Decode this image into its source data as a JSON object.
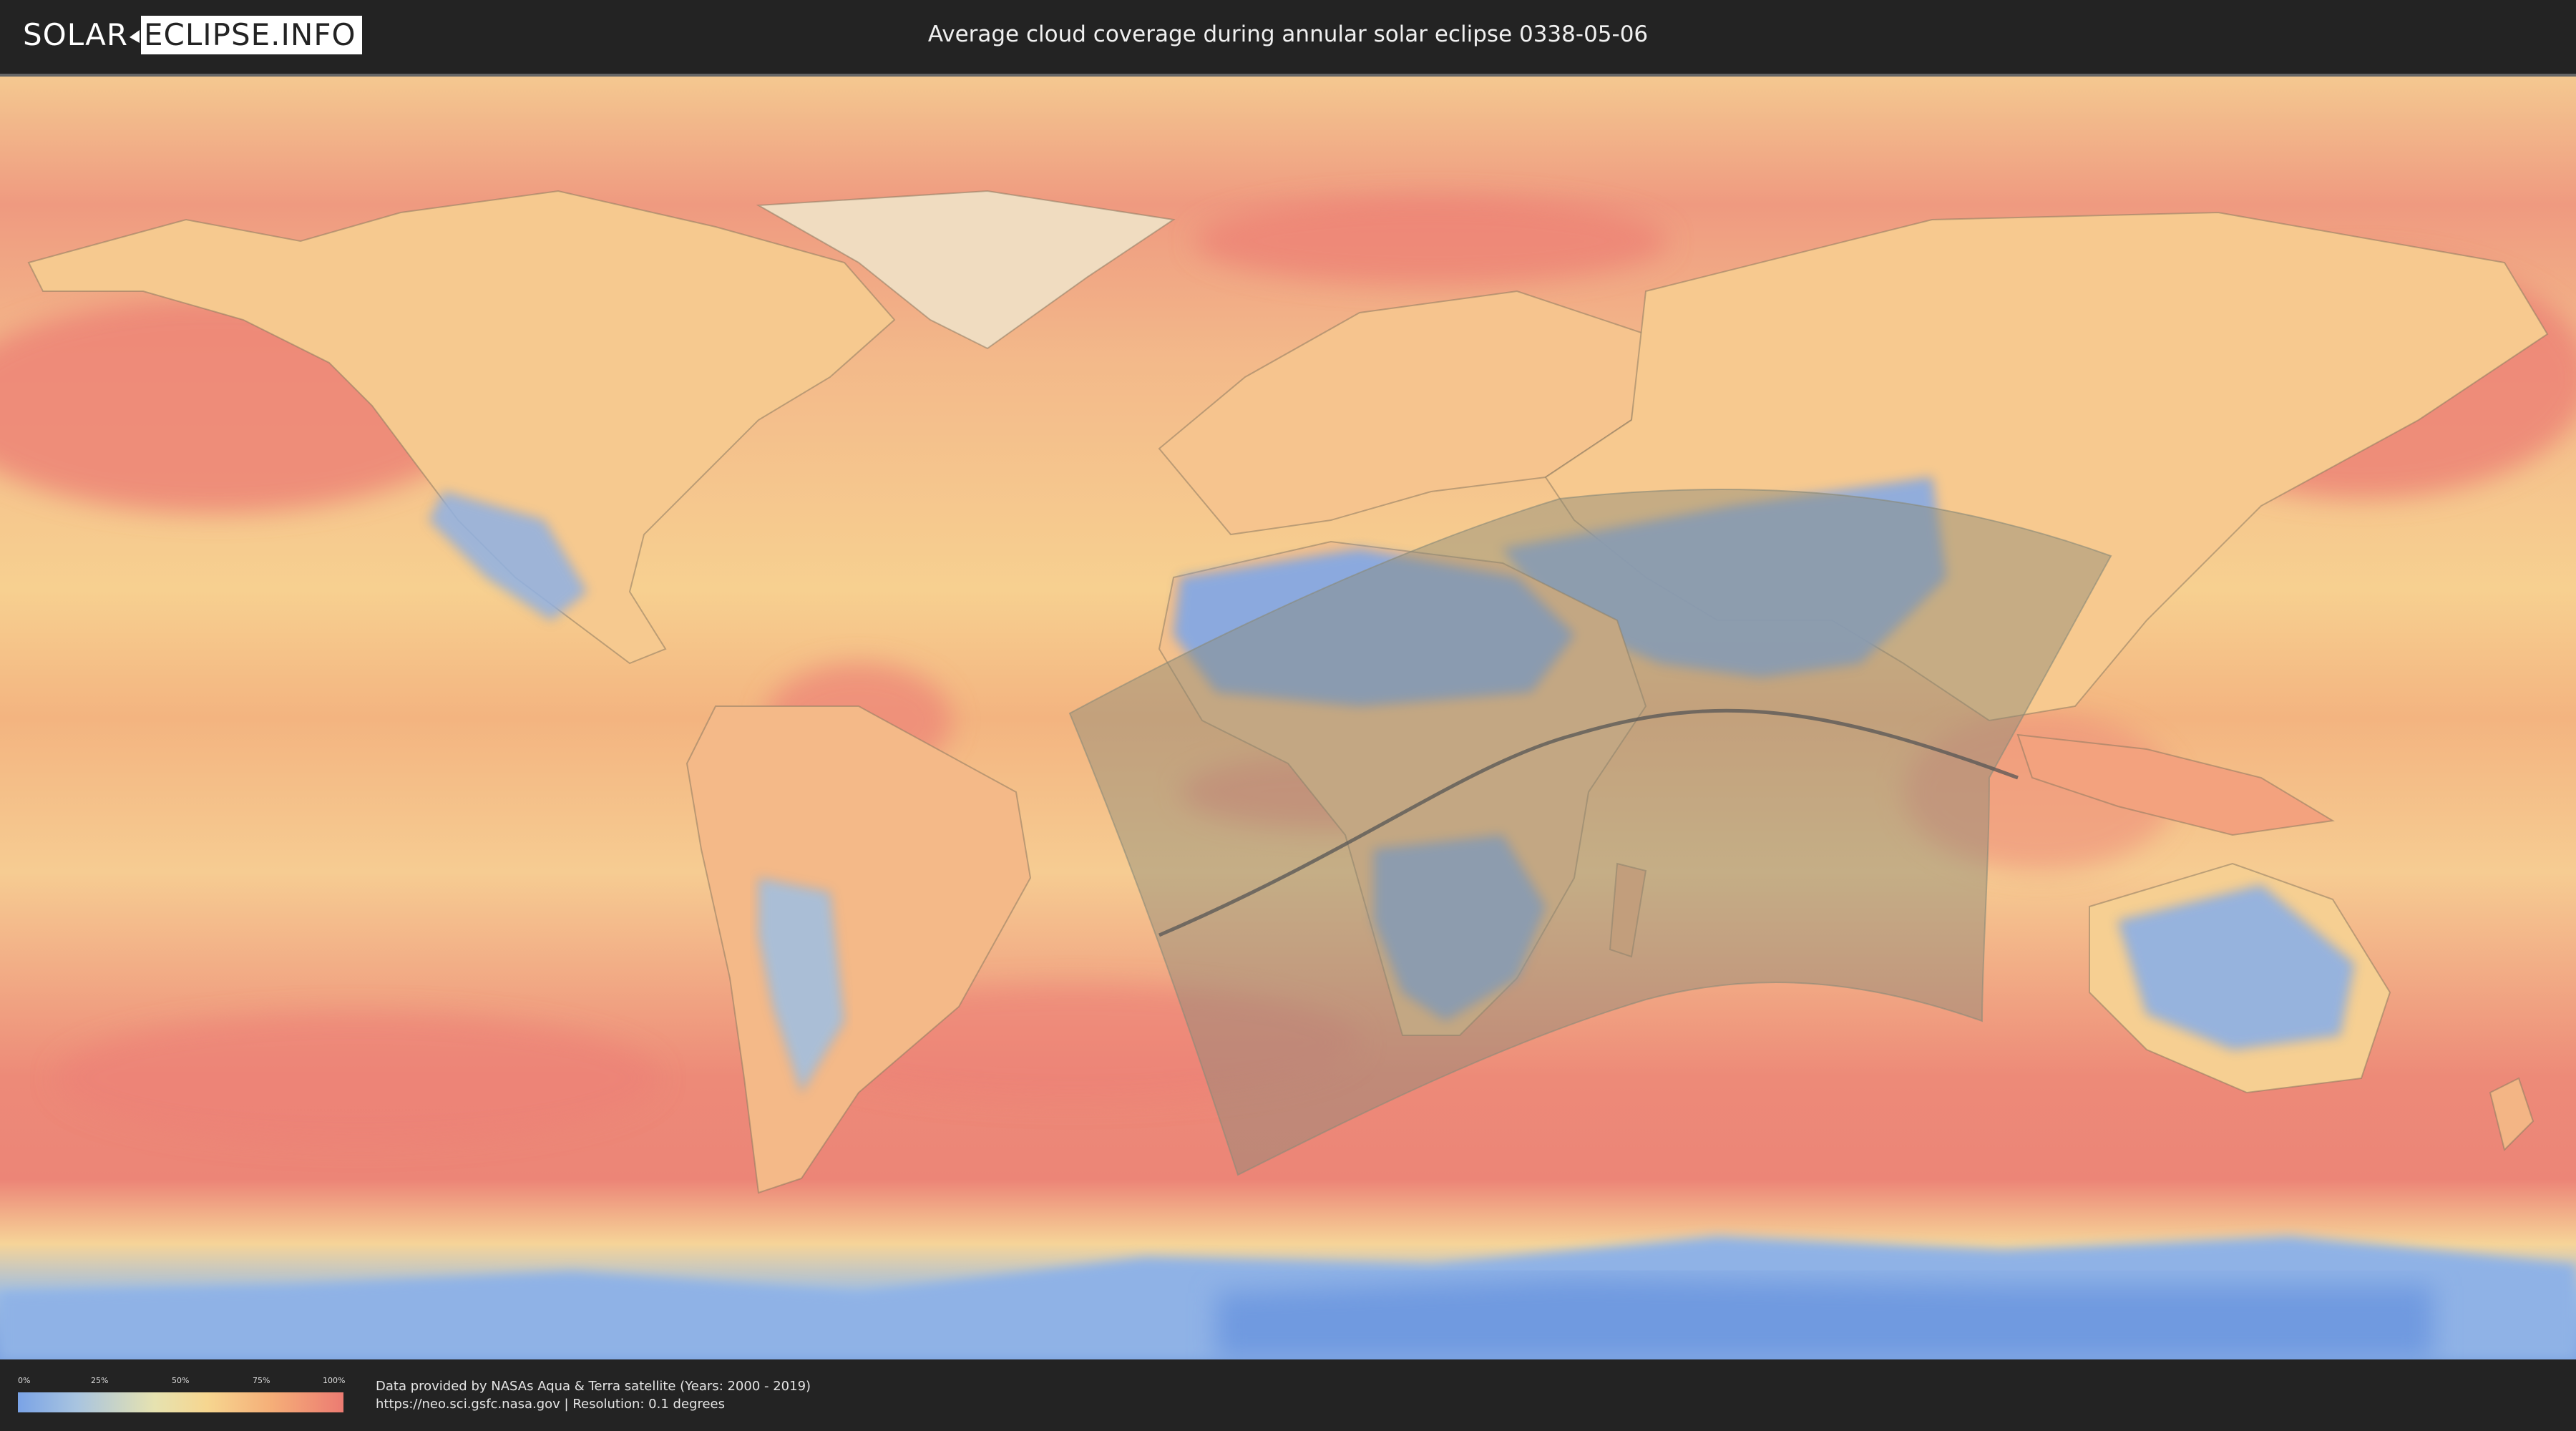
{
  "header": {
    "logo_left": "SOLAR",
    "logo_right": "ECLIPSE.INFO",
    "title": "Average cloud coverage during annular solar eclipse 0338-05-06"
  },
  "legend": {
    "ticks": [
      "0%",
      "25%",
      "50%",
      "75%",
      "100%"
    ],
    "colors": [
      "#7aa3e6",
      "#a8c4e0",
      "#e6e2b0",
      "#f6d690",
      "#f5ae78",
      "#ec7b72"
    ]
  },
  "source": {
    "line1": "Data provided by NASAs Aqua & Terra satellite (Years: 2000 - 2019)",
    "line2": "https://neo.sci.gsfc.nasa.gov | Resolution: 0.1 degrees"
  },
  "map": {
    "ocean_color": "#f0a078",
    "eclipse_zone_color": "#8a8a78",
    "central_line_color": "#555555"
  }
}
